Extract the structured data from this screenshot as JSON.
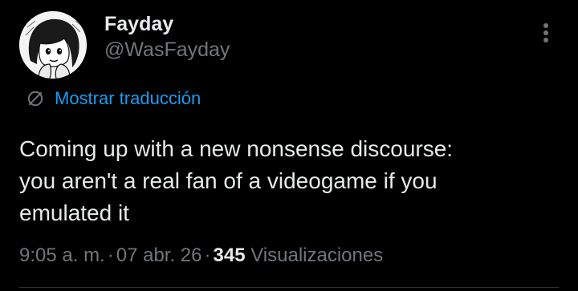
{
  "author": {
    "display_name": "Fayday",
    "handle": "@WasFayday"
  },
  "translate": {
    "label": "Mostrar traducción",
    "icon": "globe-translate-icon"
  },
  "tweet": {
    "text": "Coming up with a new nonsense discourse:\nyou aren't a real fan of a videogame if you\nemulated it"
  },
  "meta": {
    "time": "9:05 a. m.",
    "separator": "·",
    "date": "07 abr. 26",
    "views_count": "345",
    "views_label": "Visualizaciones"
  },
  "icons": {
    "more": "more-vertical-icon"
  },
  "colors": {
    "background": "#000000",
    "primary_text": "#e7e9ea",
    "secondary_text": "#71767b",
    "accent": "#1d9bf0",
    "divider": "#2f3336"
  }
}
